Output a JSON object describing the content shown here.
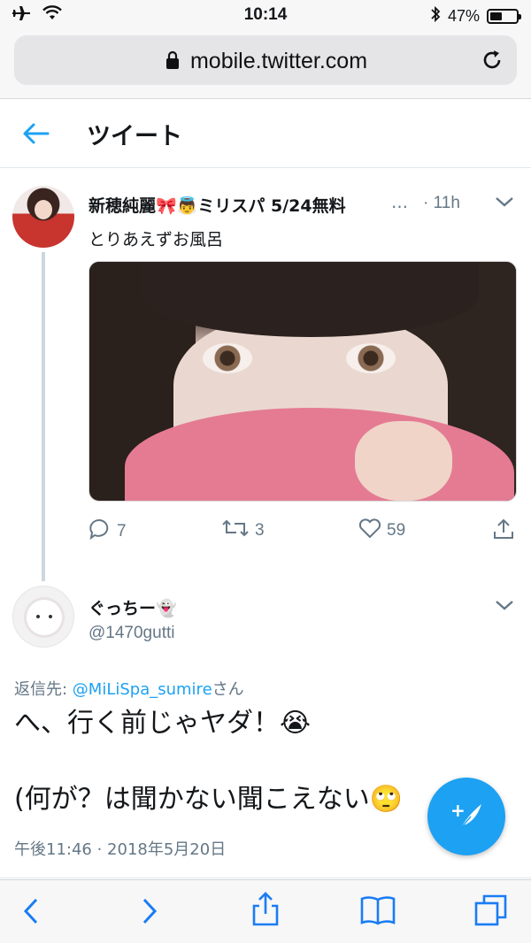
{
  "status_bar": {
    "time": "10:14",
    "battery": "47%",
    "battery_level": 0.47
  },
  "browser": {
    "url": "mobile.twitter.com"
  },
  "header": {
    "title": "ツイート"
  },
  "tweet1": {
    "name": "新穂純麗",
    "name_suffix": "ミリスパ 5/24無料",
    "ellipsis": "…",
    "separator": "·",
    "time": "11h",
    "text": "とりあえずお風呂",
    "replies": "7",
    "retweets": "3",
    "likes": "59"
  },
  "tweet2": {
    "name": "ぐっちー",
    "handle": "@1470gutti",
    "reply_prefix": "返信先: ",
    "reply_mention": "@MiLiSpa_sumire",
    "reply_suffix": "さん",
    "line1": "へ、行く前じゃヤダ！",
    "line2": "(何が？は聞かない聞こえない",
    "timestamp": "午後11:46 · 2018年5月20日"
  },
  "emojis": {
    "ribbon": "🎀",
    "angel": "👼",
    "ghost": "👻",
    "crying": "😭",
    "eyeroll": "🙄"
  },
  "colors": {
    "accent": "#1da1f2",
    "secondary_text": "#657786",
    "primary_text": "#14171a"
  }
}
